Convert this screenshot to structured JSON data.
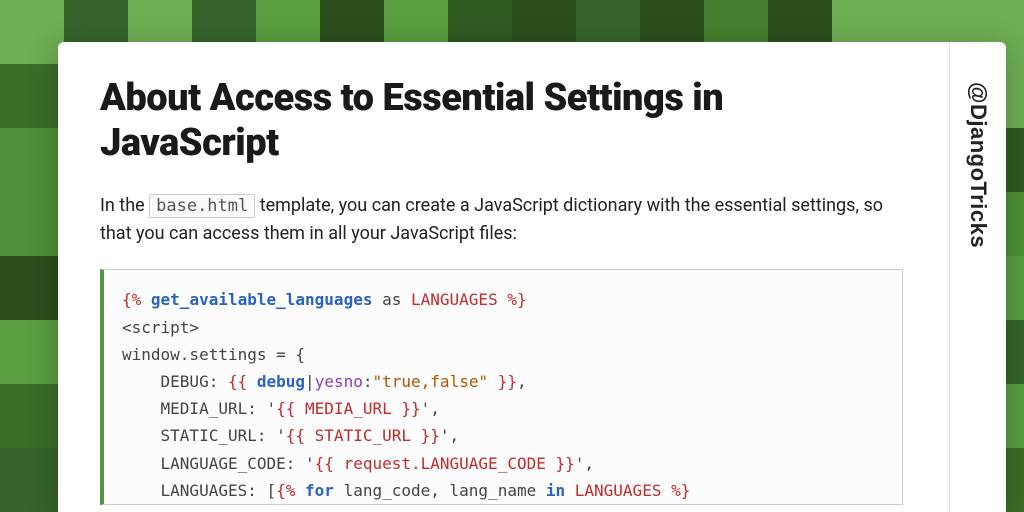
{
  "title": "About Access to Essential Settings in JavaScript",
  "handle": "@DjangoTricks",
  "lead_before": "In the ",
  "lead_code": "base.html",
  "lead_after": " template, you can create a JavaScript dictionary with the essential settings, so that you can access them in all your JavaScript files:",
  "code": {
    "l1_open": "{% ",
    "l1_kw": "get_available_languages",
    "l1_as": " as ",
    "l1_name": "LANGUAGES",
    "l1_close": " %}",
    "l2": "<script>",
    "l3": "window.settings = {",
    "l4_pre": "    DEBUG: ",
    "l4_v_open": "{{ ",
    "l4_v_kw": "debug",
    "l4_v_pipe": "|",
    "l4_v_flt": "yesno",
    "l4_v_colon": ":",
    "l4_v_str": "\"true,false\"",
    "l4_v_close": " }}",
    "l4_post": ",",
    "l5_pre": "    MEDIA_URL: '",
    "l5_v_open": "{{ ",
    "l5_v_name": "MEDIA_URL",
    "l5_v_close": " }}",
    "l5_post": "',",
    "l6_pre": "    STATIC_URL: '",
    "l6_v_open": "{{ ",
    "l6_v_name": "STATIC_URL",
    "l6_v_close": " }}",
    "l6_post": "',",
    "l7_pre": "    LANGUAGE_CODE: '",
    "l7_v_open": "{{ ",
    "l7_v_name": "request.LANGUAGE_CODE",
    "l7_v_close": " }}",
    "l7_post": "',",
    "l8_pre": "    LANGUAGES: [",
    "l8_t_open": "{% ",
    "l8_t_kw": "for",
    "l8_t_args": " lang_code, lang_name ",
    "l8_t_in": "in",
    "l8_t_name": " LANGUAGES",
    "l8_t_close": " %}"
  },
  "bg_palette": [
    "#2f5a20",
    "#3a6e28",
    "#457f30",
    "#4f8f38",
    "#5a9e41",
    "#2a4f1b",
    "#35632a",
    "#6fae54"
  ]
}
